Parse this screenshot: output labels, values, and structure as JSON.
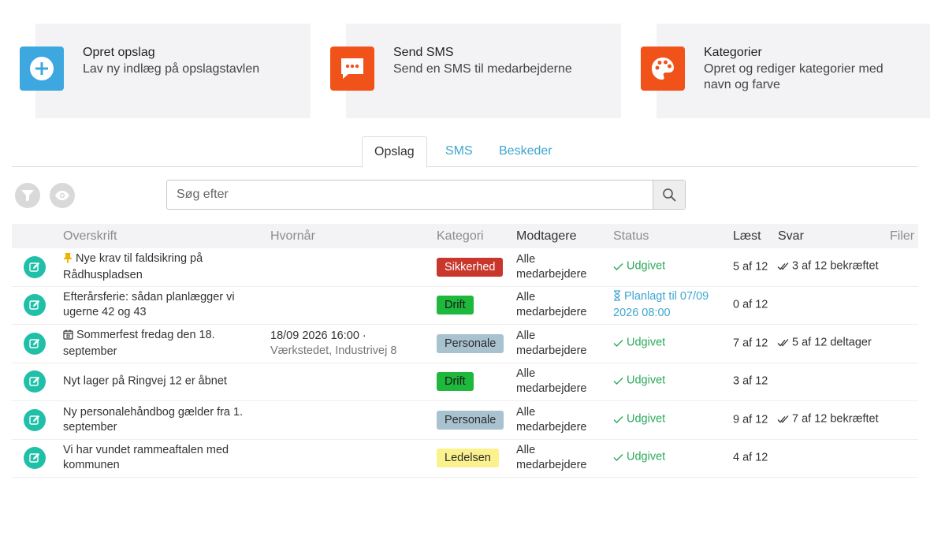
{
  "cards": [
    {
      "title": "Opret opslag",
      "desc": "Lav ny indlæg på opslagstavlen",
      "icon": "plus-circle-icon",
      "color": "#3da7e0"
    },
    {
      "title": "Send SMS",
      "desc": "Send en SMS til medarbejderne",
      "icon": "sms-bubble-icon",
      "color": "#f0521a"
    },
    {
      "title": "Kategorier",
      "desc": "Opret og rediger kategorier med navn og farve",
      "icon": "palette-icon",
      "color": "#f0521a"
    }
  ],
  "tabs": [
    "Opslag",
    "SMS",
    "Beskeder"
  ],
  "active_tab": "Opslag",
  "toolbar": {
    "filter_icon": "filter-icon",
    "visibility_icon": "eye-icon",
    "search_placeholder": "Søg efter",
    "search_icon": "search-icon"
  },
  "table": {
    "headers": {
      "title": "Overskrift",
      "when": "Hvornår",
      "category": "Kategori",
      "recipients": "Modtagere",
      "status": "Status",
      "read": "Læst",
      "replies": "Svar",
      "files": "Filer"
    },
    "rows": [
      {
        "icon": "pin-icon",
        "title": "Nye krav til faldsikring på Rådhuspladsen",
        "when": "",
        "when_sub": "",
        "category": "Sikkerhed",
        "recipients": "Alle medarbejdere",
        "status": "Udgivet",
        "status_icon": "check-icon",
        "read": "5 af 12",
        "reply": "3 af 12 bekræftet"
      },
      {
        "icon": "",
        "title": "Efterårsferie: sådan planlægger vi ugerne 42 og 43",
        "when": "",
        "when_sub": "",
        "category": "Drift",
        "recipients": "Alle medarbejdere",
        "status": "Planlagt til 07/09 2026 08:00",
        "status_icon": "hourglass-icon",
        "read": "0 af 12",
        "reply": ""
      },
      {
        "icon": "calendar-icon",
        "title": "Sommerfest fredag den 18. september",
        "when": "18/09 2026 16:00 ·",
        "when_sub": "Værkstedet, Industrivej 8",
        "category": "Personale",
        "recipients": "Alle medarbejdere",
        "status": "Udgivet",
        "status_icon": "check-icon",
        "read": "7 af 12",
        "reply": "5 af 12 deltager"
      },
      {
        "icon": "",
        "title": "Nyt lager på Ringvej 12 er åbnet",
        "when": "",
        "when_sub": "",
        "category": "Drift",
        "recipients": "Alle medarbejdere",
        "status": "Udgivet",
        "status_icon": "check-icon",
        "read": "3 af 12",
        "reply": ""
      },
      {
        "icon": "",
        "title": "Ny personalehåndbog gælder fra 1. september",
        "when": "",
        "when_sub": "",
        "category": "Personale",
        "recipients": "Alle medarbejdere",
        "status": "Udgivet",
        "status_icon": "check-icon",
        "read": "9 af 12",
        "reply": "7 af 12 bekræftet"
      },
      {
        "icon": "",
        "title": "Vi har vundet rammeaftalen med kommunen",
        "when": "",
        "when_sub": "",
        "category": "Ledelsen",
        "recipients": "Alle medarbejdere",
        "status": "Udgivet",
        "status_icon": "check-icon",
        "read": "4 af 12",
        "reply": ""
      }
    ]
  },
  "category_colors": {
    "Sikkerhed": {
      "bg": "#c9372c",
      "fg": "#ffffff"
    },
    "Drift": {
      "bg": "#1db83c",
      "fg": "#1a1a1a"
    },
    "Personale": {
      "bg": "#a9c2cf",
      "fg": "#2b2b2b"
    },
    "Ledelsen": {
      "bg": "#fbf28f",
      "fg": "#2b2b2b"
    }
  },
  "colors": {
    "accent_blue": "#3ea6cf",
    "success_green": "#2aaa5a",
    "edit_teal": "#1fbfa8"
  }
}
